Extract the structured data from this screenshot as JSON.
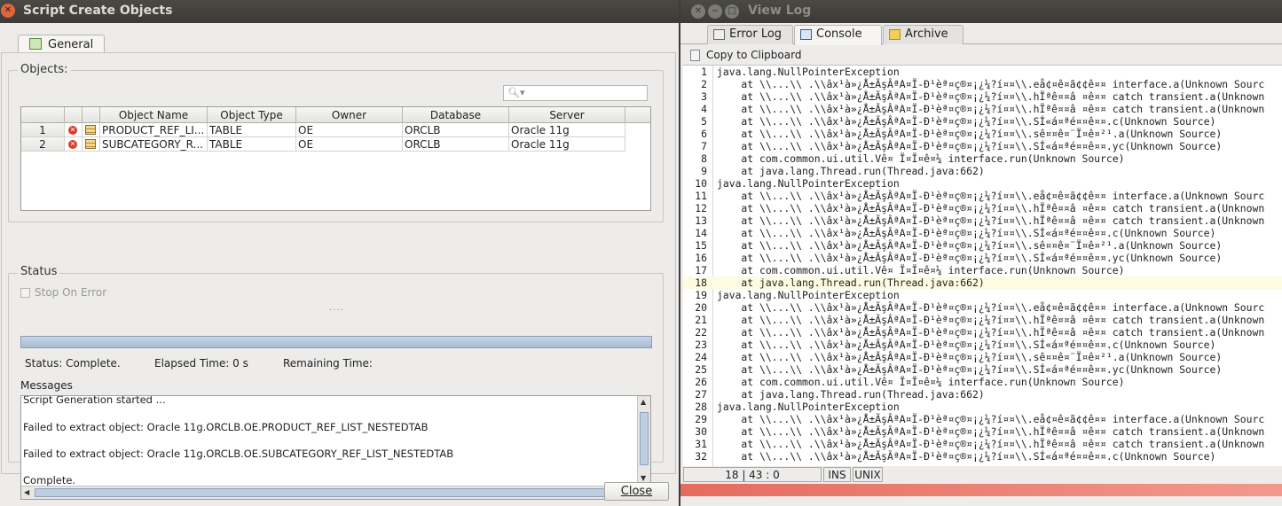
{
  "left_window": {
    "title": "Script Create Objects",
    "tab_label": "General",
    "objects_label": "Objects:",
    "search_placeholder": "",
    "table": {
      "columns": [
        "",
        "",
        "",
        "Object Name",
        "Object Type",
        "Owner",
        "Database",
        "Server"
      ],
      "rows": [
        {
          "num": "1",
          "object_name": "PRODUCT_REF_LI...",
          "object_type": "TABLE",
          "owner": "OE",
          "database": "ORCLB",
          "server": "Oracle 11g"
        },
        {
          "num": "2",
          "object_name": "SUBCATEGORY_R...",
          "object_type": "TABLE",
          "owner": "OE",
          "database": "ORCLB",
          "server": "Oracle 11g"
        }
      ]
    },
    "stop_on_error_label": "Stop On Error",
    "splitter": "....",
    "status_label": "Status",
    "status": {
      "status_text": "Status:  Complete.",
      "elapsed_text": "Elapsed Time:  0 s",
      "remaining_text": "Remaining Time:"
    },
    "progress": 1.0,
    "messages_label": "Messages",
    "messages": [
      "Script Generation started ...",
      "Failed to extract object: Oracle 11g.ORCLB.OE.PRODUCT_REF_LIST_NESTEDTAB",
      "Failed to extract object: Oracle 11g.ORCLB.OE.SUBCATEGORY_REF_LIST_NESTEDTAB",
      "Complete."
    ],
    "close_label": "Close"
  },
  "right_window": {
    "title": "View Log",
    "tabs": [
      {
        "label": "Error Log",
        "icon": "error-log-icon"
      },
      {
        "label": "Console",
        "icon": "console-icon"
      },
      {
        "label": "Archive",
        "icon": "folder-icon"
      }
    ],
    "copy_label": "Copy to Clipboard",
    "highlighted_line": 18,
    "lines": [
      "java.lang.NullPointerException",
      "    at \\\\...\\\\ .\\\\âx¹à»¿Å±ÃşÂªA¤Ï-Ð¹èª¤ç®¤¡¿¼?í¤¤\\\\.eå¢¤ê¤ã¢¢ê¤¤ interface.a(Unknown Sourc",
      "    at \\\\...\\\\ .\\\\âx¹à»¿Å±ÃşÂªA¤Ï-Ð¹èª¤ç®¤¡¿¼?í¤¤\\\\.hÏªê¤¤â ¤ê¤¤ catch transient.a(Unknown",
      "    at \\\\...\\\\ .\\\\âx¹à»¿Å±ÃşÂªA¤Ï-Ð¹èª¤ç®¤¡¿¼?í¤¤\\\\.hÏªê¤¤â ¤ê¤¤ catch transient.a(Unknown",
      "    at \\\\...\\\\ .\\\\âx¹à»¿Å±ÃşÂªA¤Ï-Ð¹èª¤ç®¤¡¿¼?í¤¤\\\\.SÍ«á¤ªé¤¤ê¤¤.c(Unknown Source)",
      "    at \\\\...\\\\ .\\\\âx¹à»¿Å±ÃşÂªA¤Ï-Ð¹èª¤ç®¤¡¿¼?í¤¤\\\\.sê¤¤ê¤¨Ï¤ê¤²¹.a(Unknown Source)",
      "    at \\\\...\\\\ .\\\\âx¹à»¿Å±ÃşÂªA¤Ï-Ð¹èª¤ç®¤¡¿¼?í¤¤\\\\.SÍ«á¤ªé¤¤ê¤¤.yc(Unknown Source)",
      "    at com.common.ui.util.Vê¤ Ï¤Ï¤ê¤¼ interface.run(Unknown Source)",
      "    at java.lang.Thread.run(Thread.java:662)",
      "java.lang.NullPointerException",
      "    at \\\\...\\\\ .\\\\âx¹à»¿Å±ÃşÂªA¤Ï-Ð¹èª¤ç®¤¡¿¼?í¤¤\\\\.eå¢¤ê¤ã¢¢ê¤¤ interface.a(Unknown Sourc",
      "    at \\\\...\\\\ .\\\\âx¹à»¿Å±ÃşÂªA¤Ï-Ð¹èª¤ç®¤¡¿¼?í¤¤\\\\.hÏªê¤¤â ¤ê¤¤ catch transient.a(Unknown",
      "    at \\\\...\\\\ .\\\\âx¹à»¿Å±ÃşÂªA¤Ï-Ð¹èª¤ç®¤¡¿¼?í¤¤\\\\.hÏªê¤¤â ¤ê¤¤ catch transient.a(Unknown",
      "    at \\\\...\\\\ .\\\\âx¹à»¿Å±ÃşÂªA¤Ï-Ð¹èª¤ç®¤¡¿¼?í¤¤\\\\.SÍ«á¤ªé¤¤ê¤¤.c(Unknown Source)",
      "    at \\\\...\\\\ .\\\\âx¹à»¿Å±ÃşÂªA¤Ï-Ð¹èª¤ç®¤¡¿¼?í¤¤\\\\.sê¤¤ê¤¨Ï¤ê¤²¹.a(Unknown Source)",
      "    at \\\\...\\\\ .\\\\âx¹à»¿Å±ÃşÂªA¤Ï-Ð¹èª¤ç®¤¡¿¼?í¤¤\\\\.SÍ«á¤ªé¤¤ê¤¤.yc(Unknown Source)",
      "    at com.common.ui.util.Vê¤ Ï¤Ï¤ê¤¼ interface.run(Unknown Source)",
      "    at java.lang.Thread.run(Thread.java:662)",
      "java.lang.NullPointerException",
      "    at \\\\...\\\\ .\\\\âx¹à»¿Å±ÃşÂªA¤Ï-Ð¹èª¤ç®¤¡¿¼?í¤¤\\\\.eå¢¤ê¤ã¢¢ê¤¤ interface.a(Unknown Sourc",
      "    at \\\\...\\\\ .\\\\âx¹à»¿Å±ÃşÂªA¤Ï-Ð¹èª¤ç®¤¡¿¼?í¤¤\\\\.hÏªê¤¤â ¤ê¤¤ catch transient.a(Unknown",
      "    at \\\\...\\\\ .\\\\âx¹à»¿Å±ÃşÂªA¤Ï-Ð¹èª¤ç®¤¡¿¼?í¤¤\\\\.hÏªê¤¤â ¤ê¤¤ catch transient.a(Unknown",
      "    at \\\\...\\\\ .\\\\âx¹à»¿Å±ÃşÂªA¤Ï-Ð¹èª¤ç®¤¡¿¼?í¤¤\\\\.SÍ«á¤ªé¤¤ê¤¤.c(Unknown Source)",
      "    at \\\\...\\\\ .\\\\âx¹à»¿Å±ÃşÂªA¤Ï-Ð¹èª¤ç®¤¡¿¼?í¤¤\\\\.sê¤¤ê¤¨Ï¤ê¤²¹.a(Unknown Source)",
      "    at \\\\...\\\\ .\\\\âx¹à»¿Å±ÃşÂªA¤Ï-Ð¹èª¤ç®¤¡¿¼?í¤¤\\\\.SÍ«á¤ªé¤¤ê¤¤.yc(Unknown Source)",
      "    at com.common.ui.util.Vê¤ Ï¤Ï¤ê¤¼ interface.run(Unknown Source)",
      "    at java.lang.Thread.run(Thread.java:662)",
      "java.lang.NullPointerException",
      "    at \\\\...\\\\ .\\\\âx¹à»¿Å±ÃşÂªA¤Ï-Ð¹èª¤ç®¤¡¿¼?í¤¤\\\\.eå¢¤ê¤ã¢¢ê¤¤ interface.a(Unknown Sourc",
      "    at \\\\...\\\\ .\\\\âx¹à»¿Å±ÃşÂªA¤Ï-Ð¹èª¤ç®¤¡¿¼?í¤¤\\\\.hÏªê¤¤â ¤ê¤¤ catch transient.a(Unknown",
      "    at \\\\...\\\\ .\\\\âx¹à»¿Å±ÃşÂªA¤Ï-Ð¹èª¤ç®¤¡¿¼?í¤¤\\\\.hÏªê¤¤â ¤ê¤¤ catch transient.a(Unknown",
      "    at \\\\...\\\\ .\\\\âx¹à»¿Å±ÃşÂªA¤Ï-Ð¹èª¤ç®¤¡¿¼?í¤¤\\\\.SÍ«á¤ªé¤¤ê¤¤.c(Unknown Source)"
    ],
    "status_bar": {
      "position": "18 | 43 : 0",
      "mode": "INS",
      "line_ending": "UNIX"
    }
  }
}
